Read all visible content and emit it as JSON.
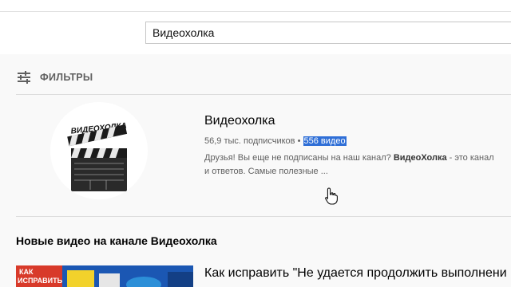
{
  "search": {
    "value": "Видеохолка"
  },
  "filters": {
    "label": "ФИЛЬТРЫ",
    "icon": "tune-icon"
  },
  "channel": {
    "logo_text": "ВИДЕОХОЛКА",
    "name": "Видеохолка",
    "subscribers": "56,9 тыс. подписчиков",
    "separator": "•",
    "video_count": "556 видео",
    "description_line1_a": "Друзья! Вы еще не подписаны на наш канал? ",
    "description_line1_bold": "ВидеоХолка",
    "description_line1_b": " - это канал",
    "description_line2": "и ответов. Самые полезные ..."
  },
  "section": {
    "title": "Новые видео на канале Видеохолка"
  },
  "video": {
    "title": "Как исправить \"Не удается продолжить выполнени",
    "thumb_text_1": "КАК",
    "thumb_text_2": "ИСПРАВИТЬ"
  },
  "colors": {
    "selection": "#2f6fd7",
    "muted_text": "#606060"
  }
}
